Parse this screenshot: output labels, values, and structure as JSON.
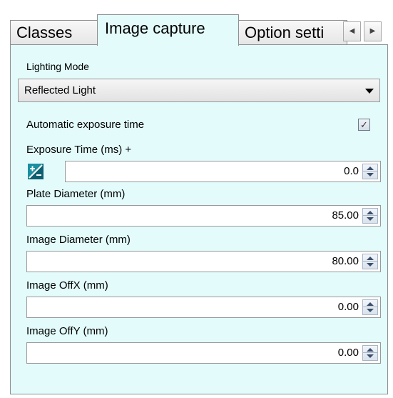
{
  "tabs": [
    {
      "label": "Classes"
    },
    {
      "label": "Image capture"
    },
    {
      "label": "Option setti"
    }
  ],
  "tab_scroll": {
    "left": "◀",
    "right": "▶"
  },
  "lighting": {
    "label": "Lighting Mode",
    "value": "Reflected Light"
  },
  "auto_exposure": {
    "label": "Automatic exposure time",
    "checked": true,
    "check_glyph": "✓"
  },
  "exposure": {
    "label": "Exposure Time (ms) +",
    "icon": "exposure-icon",
    "value": "0.0"
  },
  "plate_diameter": {
    "label": "Plate Diameter (mm)",
    "value": "85.00"
  },
  "image_diameter": {
    "label": "Image Diameter (mm)",
    "value": "80.00"
  },
  "image_offx": {
    "label": "Image OffX (mm)",
    "value": "0.00"
  },
  "image_offy": {
    "label": "Image OffY (mm)",
    "value": "0.00"
  }
}
